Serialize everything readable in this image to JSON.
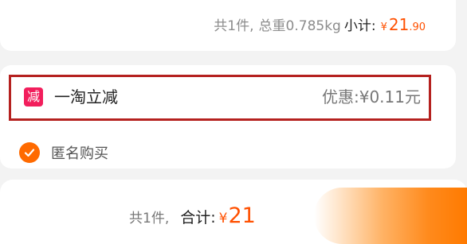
{
  "order_summary": {
    "count_text": "共1件,",
    "weight_text": "总重0.785kg",
    "subtotal_label": "小计:",
    "currency": "¥",
    "subtotal_int": "21",
    "subtotal_dec": ".90"
  },
  "discount": {
    "badge": "减",
    "title": "一淘立减",
    "amount_text": "优惠:¥0.11元"
  },
  "anonymous": {
    "label": "匿名购买",
    "checked": true
  },
  "bottom_bar": {
    "count_text": "共1件,",
    "total_label": "合计:",
    "currency": "¥",
    "total_int": "21"
  },
  "colors": {
    "accent": "#ff5000",
    "highlight_border": "#b5211f",
    "badge": "#f21e5c",
    "checkbox": "#ff6a00"
  }
}
